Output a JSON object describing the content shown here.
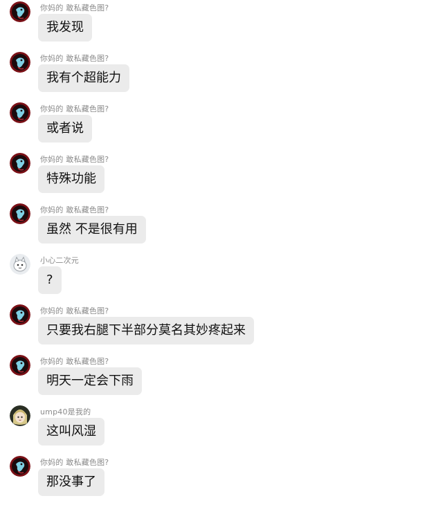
{
  "messages": [
    {
      "sender": "你妈的 敢私藏色图?",
      "text": "我发现",
      "avatar": "red-bird-avatar"
    },
    {
      "sender": "你妈的 敢私藏色图?",
      "text": "我有个超能力",
      "avatar": "red-bird-avatar"
    },
    {
      "sender": "你妈的 敢私藏色图?",
      "text": "或者说",
      "avatar": "red-bird-avatar"
    },
    {
      "sender": "你妈的 敢私藏色图?",
      "text": "特殊功能",
      "avatar": "red-bird-avatar"
    },
    {
      "sender": "你妈的 敢私藏色图?",
      "text": "虽然 不是很有用",
      "avatar": "red-bird-avatar"
    },
    {
      "sender": "小心二次元",
      "text": "?",
      "avatar": "white-animal-avatar"
    },
    {
      "sender": "你妈的 敢私藏色图?",
      "text": "只要我右腿下半部分莫名其妙疼起来",
      "avatar": "red-bird-avatar"
    },
    {
      "sender": "你妈的 敢私藏色图?",
      "text": "明天一定会下雨",
      "avatar": "red-bird-avatar"
    },
    {
      "sender": "ump40是我的",
      "text": "这叫风湿",
      "avatar": "anime-girl-avatar"
    },
    {
      "sender": "你妈的 敢私藏色图?",
      "text": "那没事了",
      "avatar": "red-bird-avatar"
    }
  ],
  "colors": {
    "bubble": "#ebebeb",
    "sender_name": "#8a8a8a",
    "message_text": "#111111",
    "avatar_red": "#7a1016",
    "avatar_blue": "#7fd0e4"
  }
}
